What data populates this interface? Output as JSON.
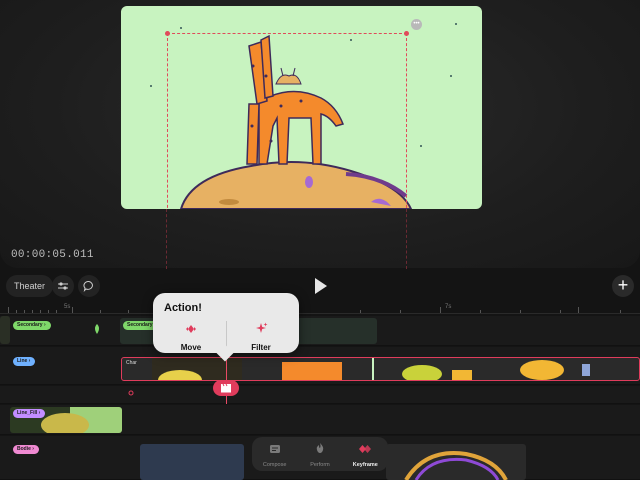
{
  "preview": {
    "timecode": "00:00:05.011",
    "canvas_bg": "#c8f3c0",
    "selection_color": "#e04a5a"
  },
  "toolbar": {
    "theater_label": "Theater",
    "adjust_icon": "sliders-icon",
    "comment_icon": "speech-bubble-icon",
    "play_icon": "play-icon",
    "add_icon": "plus-icon",
    "add_label": "+"
  },
  "ruler": {
    "labels": [
      "5s",
      "7s"
    ]
  },
  "tracks": [
    {
      "name": "Secondary",
      "color": "#7fd86a"
    },
    {
      "name": "Line",
      "color": "#6fb1ff",
      "clip_label": "Char"
    },
    {
      "name": "Line_Fill",
      "color": "#c38dff"
    },
    {
      "name": "Bodie",
      "color": "#f08ad2"
    }
  ],
  "popover": {
    "title": "Action!",
    "actions": [
      {
        "label": "Move",
        "icon": "diamond-arrows-icon"
      },
      {
        "label": "Filter",
        "icon": "sparkles-icon"
      }
    ]
  },
  "bottom_nav": {
    "items": [
      {
        "label": "Compose",
        "icon": "compose-icon"
      },
      {
        "label": "Perform",
        "icon": "flame-icon"
      },
      {
        "label": "Keyframe",
        "icon": "keyframe-icon"
      }
    ],
    "active": "Keyframe"
  },
  "accent": "#e03c5c"
}
